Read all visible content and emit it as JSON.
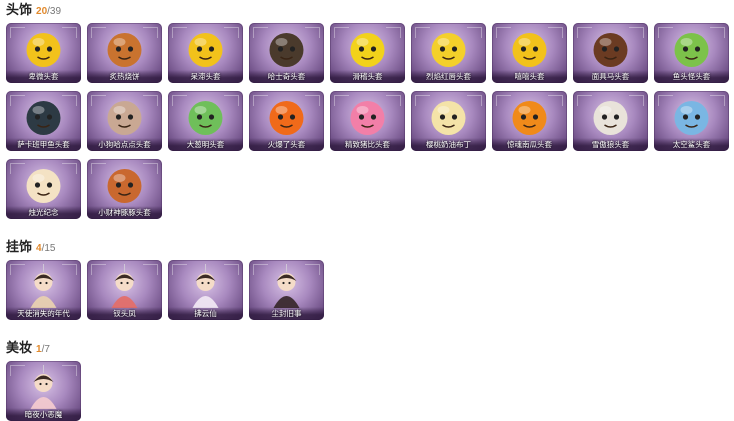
{
  "sections": [
    {
      "title": "头饰",
      "owned": "20",
      "total": "/39",
      "items": [
        {
          "label": "卑微头套",
          "icon": "sad-emoji-head-icon",
          "color": "#f2c21b"
        },
        {
          "label": "炙热烧饼",
          "icon": "toast-head-icon",
          "color": "#c9732f"
        },
        {
          "label": "呆滞头套",
          "icon": "dazed-emoji-head-icon",
          "color": "#f2c21b"
        },
        {
          "label": "哈士奇头套",
          "icon": "husky-head-icon",
          "color": "#4a3a2c"
        },
        {
          "label": "滑稽头套",
          "icon": "smirk-emoji-head-icon",
          "color": "#f2d21b"
        },
        {
          "label": "烈焰红唇头套",
          "icon": "yellow-creature-head-icon",
          "color": "#f4d02a"
        },
        {
          "label": "嘻嘻头套",
          "icon": "grin-emoji-head-icon",
          "color": "#f2c21b"
        },
        {
          "label": "面具马头套",
          "icon": "horse-head-icon",
          "color": "#6b3b22"
        },
        {
          "label": "鱼头怪头套",
          "icon": "fish-monster-head-icon",
          "color": "#7cc24a"
        },
        {
          "label": "萨卡班甲鱼头套",
          "icon": "armored-fish-head-icon",
          "color": "#2d3a44"
        },
        {
          "label": "小狗哈点点头套",
          "icon": "puppy-head-icon",
          "color": "#c9a893"
        },
        {
          "label": "大葱明头套",
          "icon": "bok-choy-head-icon",
          "color": "#6fbf5a"
        },
        {
          "label": "火爆了头套",
          "icon": "fire-head-icon",
          "color": "#f06a1a"
        },
        {
          "label": "精致猪比头套",
          "icon": "pink-pig-head-icon",
          "color": "#f27fa8"
        },
        {
          "label": "樱桃奶油布丁",
          "icon": "pudding-head-icon",
          "color": "#f4e3a8"
        },
        {
          "label": "惊魂南瓜头套",
          "icon": "pumpkin-head-icon",
          "color": "#f08a1a"
        },
        {
          "label": "雪傲狼头套",
          "icon": "snow-reindeer-head-icon",
          "color": "#e9e3da"
        },
        {
          "label": "太空鲨头套",
          "icon": "space-shark-head-icon",
          "color": "#7ab6e3"
        },
        {
          "label": "烛光纪念",
          "icon": "candle-head-icon",
          "color": "#f4e2c4"
        },
        {
          "label": "小财神豚豚头套",
          "icon": "fortune-pig-head-icon",
          "color": "#c9682f"
        }
      ]
    },
    {
      "title": "挂饰",
      "owned": "4",
      "total": "/15",
      "items": [
        {
          "label": "天使消失的年代",
          "icon": "angel-charm-icon",
          "color": "#e8d0b0"
        },
        {
          "label": "钗头凤",
          "icon": "phoenix-hairpin-charm-icon",
          "color": "#e36f6a"
        },
        {
          "label": "拂云仙",
          "icon": "cloud-fairy-charm-icon",
          "color": "#efe6f2"
        },
        {
          "label": "尘封旧事",
          "icon": "dusty-memory-charm-icon",
          "color": "#3a2a2e"
        }
      ]
    },
    {
      "title": "美妆",
      "owned": "1",
      "total": "/7",
      "items": [
        {
          "label": "暗夜小恶魔",
          "icon": "little-devil-makeup-icon",
          "color": "#f2c9cf"
        }
      ]
    }
  ]
}
